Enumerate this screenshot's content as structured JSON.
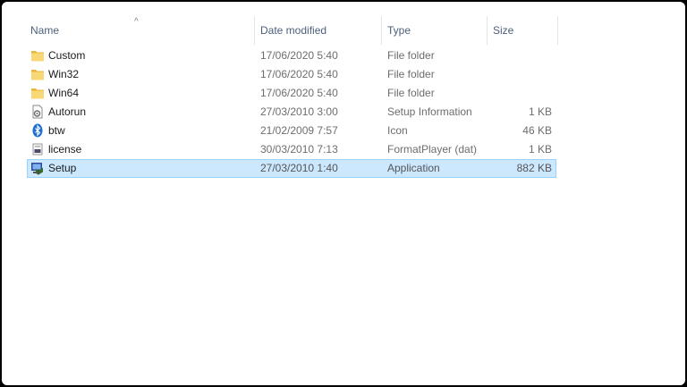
{
  "columns": {
    "name": "Name",
    "date_modified": "Date modified",
    "type": "Type",
    "size": "Size"
  },
  "sort": {
    "column": "name",
    "direction": "ascending"
  },
  "files": [
    {
      "name": "Custom",
      "date": "17/06/2020 5:40",
      "type": "File folder",
      "size": "",
      "icon": "folder-icon"
    },
    {
      "name": "Win32",
      "date": "17/06/2020 5:40",
      "type": "File folder",
      "size": "",
      "icon": "folder-icon"
    },
    {
      "name": "Win64",
      "date": "17/06/2020 5:40",
      "type": "File folder",
      "size": "",
      "icon": "folder-icon"
    },
    {
      "name": "Autorun",
      "date": "27/03/2010 3:00",
      "type": "Setup Information",
      "size": "1 KB",
      "icon": "settings-file-icon"
    },
    {
      "name": "btw",
      "date": "21/02/2009 7:57",
      "type": "Icon",
      "size": "46 KB",
      "icon": "bluetooth-icon"
    },
    {
      "name": "license",
      "date": "30/03/2010 7:13",
      "type": "FormatPlayer (dat)",
      "size": "1 KB",
      "icon": "dat-file-icon"
    },
    {
      "name": "Setup",
      "date": "27/03/2010 1:40",
      "type": "Application",
      "size": "882 KB",
      "icon": "setup-app-icon",
      "selected": true
    }
  ],
  "colors": {
    "selection_bg": "#cce8ff",
    "selection_border": "#99d1ff",
    "header_text": "#4c607a",
    "folder": "#f8d775"
  }
}
